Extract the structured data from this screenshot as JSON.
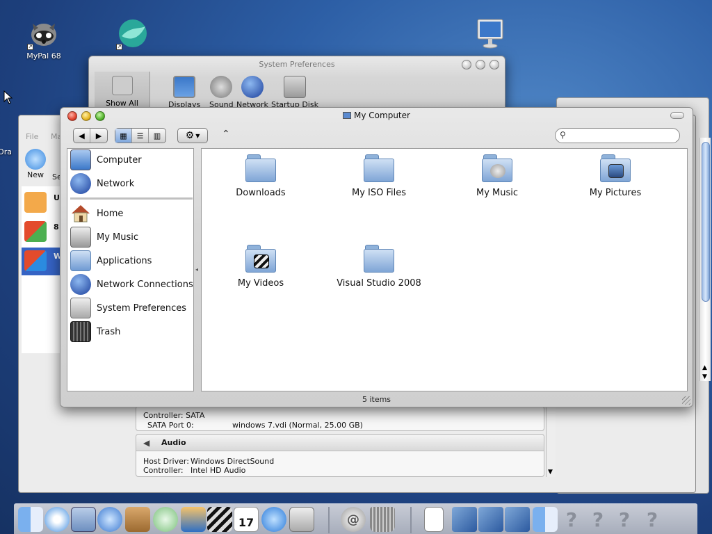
{
  "desktop": {
    "icons": [
      {
        "label": "MyPal 68",
        "icon": "raccoon-icon"
      },
      {
        "label": "",
        "icon": "globe-leaf-icon"
      },
      {
        "label": "",
        "icon": "monitor-icon"
      }
    ]
  },
  "system_preferences": {
    "title": "System Preferences",
    "items": [
      "Show All",
      "Displays",
      "Sound",
      "Network",
      "Startup Disk"
    ]
  },
  "vbox": {
    "toolbar": [
      "File",
      "Ma"
    ],
    "new_label": "New",
    "side_label": "Se",
    "partial_label": "Ora",
    "vm_rows": [
      {
        "short": "U",
        "icon": "vm-ubuntu-icon"
      },
      {
        "short": "8",
        "icon": "vm-win7-icon"
      },
      {
        "short": "W",
        "icon": "vm-win7-selected-icon"
      }
    ],
    "storage": {
      "controller_text": "Controller: SATA",
      "port_label": "SATA Port 0:",
      "port_value": "windows 7.vdi (Normal, 25.00 GB)"
    },
    "audio": {
      "header": "Audio",
      "host_driver_label": "Host Driver:",
      "host_driver_value": "Windows DirectSound",
      "controller_label": "Controller:",
      "controller_value": "Intel HD Audio"
    }
  },
  "finder": {
    "title": "My Computer",
    "status": "5 items",
    "sidebar": [
      {
        "label": "Computer",
        "icon": "computer-icon",
        "color": "#6d9ad6"
      },
      {
        "label": "Network",
        "icon": "network-globe-icon",
        "color": "#2a5fc1"
      },
      {
        "label": "Home",
        "icon": "home-icon",
        "color": "#c9894a"
      },
      {
        "label": "My Music",
        "icon": "music-icon",
        "color": "#8a8a8a"
      },
      {
        "label": "Applications",
        "icon": "applications-icon",
        "color": "#7ba3d6"
      },
      {
        "label": "Network Connections",
        "icon": "network-connections-icon",
        "color": "#2a5fc1"
      },
      {
        "label": "System Preferences",
        "icon": "system-preferences-icon",
        "color": "#a7a7a7"
      },
      {
        "label": "Trash",
        "icon": "trash-icon",
        "color": "#2a2a2a"
      }
    ],
    "folders": [
      {
        "label": "Downloads",
        "badge": ""
      },
      {
        "label": "My ISO Files",
        "badge": ""
      },
      {
        "label": "My Music",
        "badge": "music-note-icon"
      },
      {
        "label": "My Pictures",
        "badge": "pictures-icon"
      },
      {
        "label": "My Videos",
        "badge": "film-clapper-icon"
      },
      {
        "label": "Visual Studio 2008",
        "badge": ""
      }
    ]
  },
  "dock": {
    "items": [
      "finder-icon",
      "safari-icon",
      "mail-icon",
      "ichat-icon",
      "address-book-icon",
      "itunes-icon",
      "iphoto-icon",
      "imovie-icon",
      "ical-icon",
      "quicktime-icon",
      "system-preferences-icon",
      "mail-at-icon",
      "trash-icon",
      "document-icon",
      "virtualbox-icon",
      "virtualbox-icon",
      "virtualbox-icon",
      "finder-icon",
      "help-icon",
      "help-icon",
      "help-icon",
      "help-icon"
    ],
    "ical_day": "17"
  }
}
